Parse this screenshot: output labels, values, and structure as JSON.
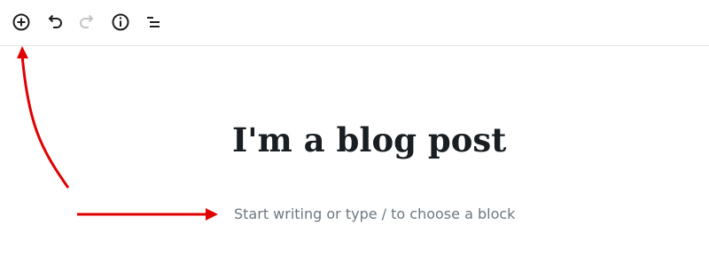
{
  "toolbar": {
    "buttons": [
      {
        "name": "add-block-button",
        "icon": "plus-circle-icon",
        "label": "Add block",
        "enabled": true
      },
      {
        "name": "undo-button",
        "icon": "undo-icon",
        "label": "Undo",
        "enabled": true
      },
      {
        "name": "redo-button",
        "icon": "redo-icon",
        "label": "Redo",
        "enabled": false
      },
      {
        "name": "info-button",
        "icon": "info-icon",
        "label": "Content structure",
        "enabled": true
      },
      {
        "name": "outline-button",
        "icon": "list-outline-icon",
        "label": "Block navigation",
        "enabled": true
      }
    ]
  },
  "editor": {
    "title": "I'm a blog post",
    "placeholder": "Start writing or type / to choose a block"
  },
  "colors": {
    "icon": "#1e1e1e",
    "icon_disabled": "#c3c4c7",
    "title": "#191e23",
    "placeholder": "#6c7781",
    "annotation": "#e00000",
    "divider": "#e2e4e7"
  }
}
